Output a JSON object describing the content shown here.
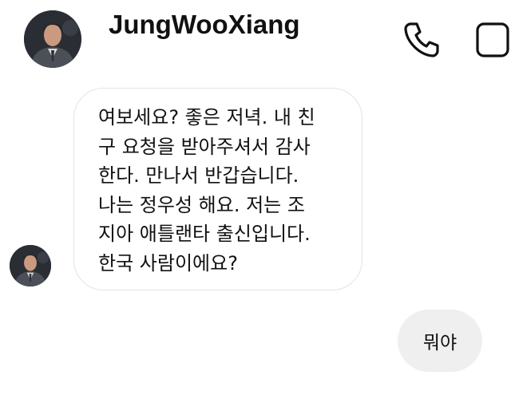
{
  "header": {
    "username": "JungWooXiang",
    "avatar_icon": "profile-photo",
    "call_icon": "phone-icon",
    "video_icon": "video-icon"
  },
  "messages": [
    {
      "direction": "incoming",
      "text": "여보세요? 좋은 저녁. 내 친\n구 요청을 받아주셔서 감사\n한다. 만나서 반갑습니다.\n나는 정우성 해요. 저는 조\n지아 애틀랜타 출신입니다.\n한국 사람이에요?"
    },
    {
      "direction": "outgoing",
      "text": "뭐야"
    }
  ],
  "colors": {
    "background": "#ffffff",
    "incoming_bubble_border": "#e3e3e3",
    "outgoing_bubble_bg": "#efefef",
    "text": "#111111"
  }
}
